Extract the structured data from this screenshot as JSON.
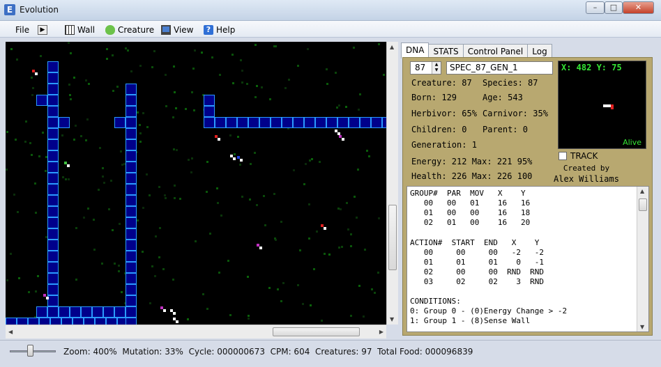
{
  "window": {
    "title": "Evolution"
  },
  "menu": {
    "file": "File",
    "wall": "Wall",
    "creature": "Creature",
    "view": "View",
    "help": "Help"
  },
  "tabs": [
    "DNA",
    "STATS",
    "Control Panel",
    "Log"
  ],
  "dna": {
    "creature_number": "87",
    "species_name": "SPEC_87_GEN_1",
    "creature": "Creature: 87",
    "species": "Species: 87",
    "born": "Born: 129",
    "age": "Age: 543",
    "herbivor": "Herbivor: 65%",
    "carnivor": "Carnivor: 35%",
    "children": "Children: 0",
    "parent": "Parent:  0",
    "generation": "Generation: 1",
    "energy": "Energy: 212  Max: 221  95%",
    "health": "Health: 226  Max: 226  100",
    "viewer_xy": "X: 482  Y: 75",
    "viewer_status": "Alive",
    "track_label": "TRACK",
    "created_by": "Created by",
    "author": "Alex Williams"
  },
  "dna_listing": [
    "GROUP#  PAR  MOV   X    Y",
    "   00   00   01    16   16",
    "   01   00   00    16   18",
    "   02   01   00    16   20",
    "",
    "ACTION#  START  END   X    Y",
    "   00     00     00   -2   -2",
    "   01     01     01    0   -1",
    "   02     00     00  RND  RND",
    "   03     02     02    3  RND",
    "",
    "CONDITIONS:",
    "0: Group 0 - (0)Energy Change > -2",
    "1: Group 1 - (8)Sense Wall"
  ],
  "status": {
    "zoom": "Zoom: 400%",
    "mutation": "Mutation: 33%",
    "cycle": "Cycle: 000000673",
    "cpm": "CPM: 604",
    "creatures": "Creatures: 97",
    "total_food": "Total Food: 000096839"
  },
  "colors": {
    "wall_fill": "#00008b",
    "wall_stroke": "#2a9bff",
    "panel_bg": "#b8a870",
    "viewer_text": "#35e635"
  }
}
